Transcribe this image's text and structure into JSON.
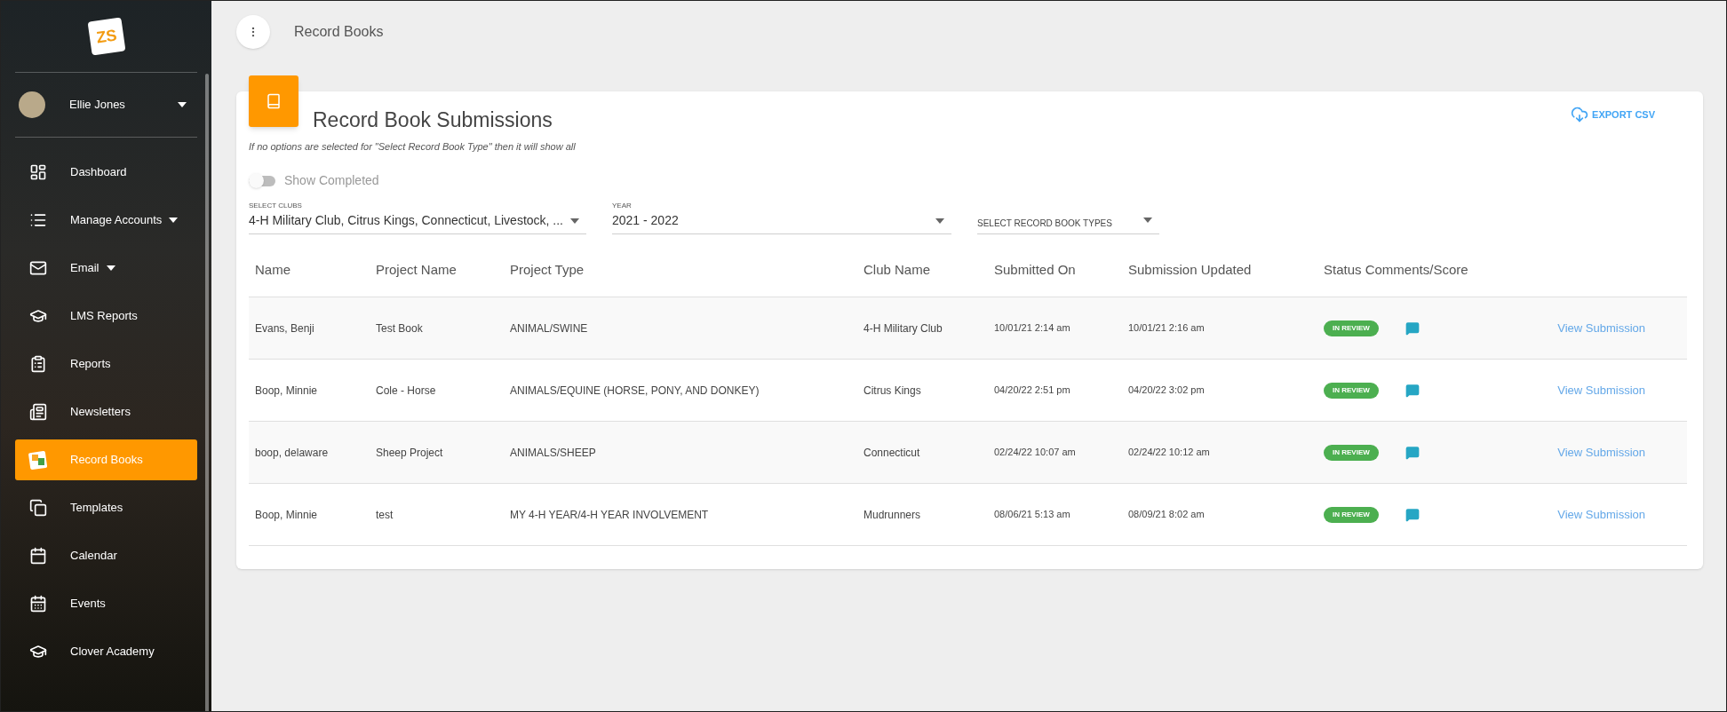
{
  "sidebar": {
    "logo_text": "ZS",
    "user": {
      "name": "Ellie Jones"
    },
    "items": [
      {
        "label": "Dashboard",
        "kind": "link",
        "selected": false
      },
      {
        "label": "Manage Accounts",
        "kind": "group",
        "selected": false
      },
      {
        "label": "Email",
        "kind": "group",
        "selected": false
      },
      {
        "label": "LMS Reports",
        "kind": "link",
        "selected": false
      },
      {
        "label": "Reports",
        "kind": "link",
        "selected": false
      },
      {
        "label": "Newsletters",
        "kind": "link",
        "selected": false
      },
      {
        "label": "Record Books",
        "kind": "link",
        "selected": true
      },
      {
        "label": "Templates",
        "kind": "link",
        "selected": false
      },
      {
        "label": "Calendar",
        "kind": "link",
        "selected": false
      },
      {
        "label": "Events",
        "kind": "link",
        "selected": false
      },
      {
        "label": "Clover Academy",
        "kind": "link",
        "selected": false
      }
    ]
  },
  "header": {
    "title": "Record Books"
  },
  "card": {
    "title": "Record Book Submissions",
    "export_label": "EXPORT CSV",
    "note": "If no options are selected for \"Select Record Book Type\" then it will show all",
    "toggle": {
      "label": "Show Completed",
      "on": false
    },
    "filters": [
      {
        "label": "SELECT CLUBS",
        "value": "4-H Military Club, Citrus Kings, Connecticut, Livestock, ..."
      },
      {
        "label": "YEAR",
        "value": "2021 - 2022"
      },
      {
        "placeholder": "SELECT RECORD BOOK TYPES"
      }
    ],
    "table": {
      "columns": [
        "Name",
        "Project Name",
        "Project Type",
        "Club Name",
        "Submitted On",
        "Submission Updated",
        "Status Comments/Score"
      ],
      "rows": [
        {
          "name": "Evans, Benji",
          "project_name": "Test Book",
          "project_type": "ANIMAL/SWINE",
          "club": "4-H Military Club",
          "submitted": "10/01/21 2:14 am",
          "updated": "10/01/21 2:16 am",
          "status": "IN REVIEW",
          "link": "View Submission"
        },
        {
          "name": "Boop, Minnie",
          "project_name": "Cole - Horse",
          "project_type": "ANIMALS/EQUINE (HORSE, PONY, AND DONKEY)",
          "club": "Citrus Kings",
          "submitted": "04/20/22 2:51 pm",
          "updated": "04/20/22 3:02 pm",
          "status": "IN REVIEW",
          "link": "View Submission"
        },
        {
          "name": "boop, delaware",
          "project_name": "Sheep Project",
          "project_type": "ANIMALS/SHEEP",
          "club": "Connecticut",
          "submitted": "02/24/22 10:07 am",
          "updated": "02/24/22 10:12 am",
          "status": "IN REVIEW",
          "link": "View Submission"
        },
        {
          "name": "Boop, Minnie",
          "project_name": "test",
          "project_type": "MY 4-H YEAR/4-H YEAR INVOLVEMENT",
          "club": "Mudrunners",
          "submitted": "08/06/21 5:13 am",
          "updated": "08/09/21 8:02 am",
          "status": "IN REVIEW",
          "link": "View Submission"
        }
      ]
    }
  }
}
